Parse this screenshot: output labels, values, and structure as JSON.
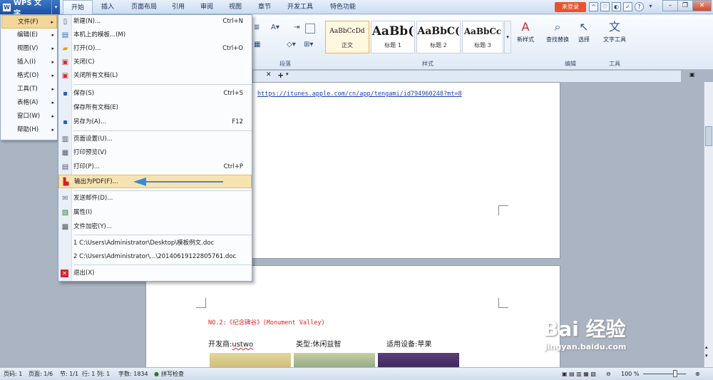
{
  "app": {
    "name": "WPS 文字",
    "login": "未登录"
  },
  "tabs": [
    "开始",
    "插入",
    "页面布局",
    "引用",
    "审阅",
    "视图",
    "章节",
    "开发工具",
    "特色功能"
  ],
  "ribbon": {
    "styles": [
      {
        "sample": "AaBbCcDd",
        "name": "正文"
      },
      {
        "sample": "AaBb(",
        "name": "标题 1"
      },
      {
        "sample": "AaBbC(",
        "name": "标题 2"
      },
      {
        "sample": "AaBbCc",
        "name": "标题 3"
      }
    ],
    "new_style": "新样式",
    "find_replace": "查找替换",
    "select": "选择",
    "text_tools": "文字工具",
    "groups": {
      "paragraph": "段落",
      "style": "样式",
      "edit": "编辑",
      "tools": "工具"
    }
  },
  "side_menu": [
    {
      "label": "文件(F)",
      "arrow": "▸"
    },
    {
      "label": "编辑(E)",
      "arrow": "▸"
    },
    {
      "label": "视图(V)",
      "arrow": "▸"
    },
    {
      "label": "插入(I)",
      "arrow": "▸"
    },
    {
      "label": "格式(O)",
      "arrow": "▸"
    },
    {
      "label": "工具(T)",
      "arrow": "▸"
    },
    {
      "label": "表格(A)",
      "arrow": "▸"
    },
    {
      "label": "窗口(W)",
      "arrow": "▸"
    },
    {
      "label": "帮助(H)",
      "arrow": "▸"
    }
  ],
  "file_menu": [
    {
      "label": "新建(N)...",
      "shortcut": "Ctrl+N",
      "icon": "new-doc-icon"
    },
    {
      "label": "本机上的模板...(M)",
      "shortcut": "",
      "icon": "template-icon"
    },
    {
      "label": "打开(O)...",
      "shortcut": "Ctrl+O",
      "icon": "open-folder-icon"
    },
    {
      "label": "关闭(C)",
      "shortcut": "",
      "icon": "close-doc-icon"
    },
    {
      "label": "关闭所有文档(L)",
      "shortcut": "",
      "icon": "close-all-icon"
    },
    {
      "label": "保存(S)",
      "shortcut": "Ctrl+S",
      "icon": "save-icon"
    },
    {
      "label": "保存所有文档(E)",
      "shortcut": "",
      "icon": "save-all-icon"
    },
    {
      "label": "另存为(A)...",
      "shortcut": "F12",
      "icon": "save-as-icon"
    },
    {
      "label": "页面设置(U)...",
      "shortcut": "",
      "icon": "page-setup-icon"
    },
    {
      "label": "打印预览(V)",
      "shortcut": "",
      "icon": "print-preview-icon"
    },
    {
      "label": "打印(P)...",
      "shortcut": "Ctrl+P",
      "icon": "print-icon"
    },
    {
      "label": "输出为PDF(F)...",
      "shortcut": "",
      "icon": "pdf-icon"
    },
    {
      "label": "发送邮件(D)...",
      "shortcut": "",
      "icon": "mail-icon"
    },
    {
      "label": "属性(I)",
      "shortcut": "",
      "icon": "properties-icon"
    },
    {
      "label": "文件加密(Y)...",
      "shortcut": "",
      "icon": "encrypt-icon"
    },
    {
      "label": "1 C:\\Users\\Administrator\\Desktop\\模板例文.doc",
      "shortcut": "",
      "icon": ""
    },
    {
      "label": "2 C:\\Users\\Administrator\\...\\20140619122805761.doc",
      "shortcut": "",
      "icon": ""
    },
    {
      "label": "退出(X)",
      "shortcut": "",
      "icon": "exit-icon"
    }
  ],
  "document": {
    "url": "https://itunes.apple.com/cn/app/tengami/id794960248?mt=8",
    "heading": "NO.2:《纪念碑谷》(Monument Valley)",
    "developer_label": "开发商:",
    "developer": "ustwo",
    "type": "类型:休闲益智",
    "device": "适用设备:苹果"
  },
  "status": {
    "page_num": "页码: 1",
    "pages": "页面: 1/6",
    "section": "节: 1/1",
    "row_col": "行: 1  列: 1",
    "words": "字数: 1834",
    "spell": "拼写检查",
    "zoom": "100 %"
  },
  "watermark": {
    "main": "Bai 经验",
    "sub": "jingyan.baidu.com"
  }
}
